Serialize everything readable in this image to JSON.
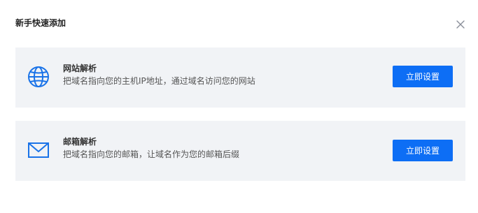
{
  "dialog": {
    "title": "新手快速添加",
    "close_icon": "close-icon"
  },
  "cards": [
    {
      "icon": "globe-icon",
      "title": "网站解析",
      "description": "把域名指向您的主机IP地址，通过域名访问您的网站",
      "button_label": "立即设置"
    },
    {
      "icon": "mail-icon",
      "title": "邮箱解析",
      "description": "把域名指向您的邮箱，让域名作为您的邮箱后缀",
      "button_label": "立即设置"
    }
  ],
  "colors": {
    "accent": "#0d6ef5",
    "card_background": "#f1f3f6",
    "icon": "#1a73e8"
  }
}
